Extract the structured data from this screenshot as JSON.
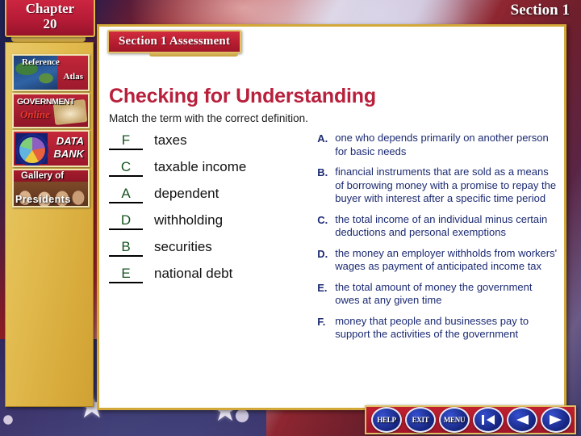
{
  "header": {
    "chapter_line1": "Chapter",
    "chapter_line2": "20",
    "section_label": "Section 1"
  },
  "sidebar": {
    "buttons": [
      {
        "name": "reference-atlas",
        "line1": "Reference",
        "line2": "Atlas"
      },
      {
        "name": "government-online",
        "line1": "GOVERNMENT",
        "line2": "Online"
      },
      {
        "name": "data-bank",
        "line1": "DATA",
        "line2": "BANK"
      },
      {
        "name": "gallery-of-presidents",
        "line1": "Gallery of",
        "line2": "Presidents"
      }
    ]
  },
  "main": {
    "assessment_banner": "Section 1 Assessment",
    "title": "Checking for Understanding",
    "instruction": "Match the term with the correct definition.",
    "terms": [
      {
        "answer": "F",
        "term": "taxes"
      },
      {
        "answer": "C",
        "term": "taxable income"
      },
      {
        "answer": "A",
        "term": "dependent"
      },
      {
        "answer": "D",
        "term": "withholding"
      },
      {
        "answer": "B",
        "term": "securities"
      },
      {
        "answer": "E",
        "term": "national debt"
      }
    ],
    "definitions": [
      {
        "letter": "A.",
        "text": "one who depends primarily on another person for basic needs"
      },
      {
        "letter": "B.",
        "text": "financial instruments that are sold as a means of borrowing money with a promise to repay the buyer with interest after a specific time period"
      },
      {
        "letter": "C.",
        "text": "the total income of an individual minus certain deductions and personal exemptions"
      },
      {
        "letter": "D.",
        "text": "the money an employer withholds from workers' wages as payment of anticipated income tax"
      },
      {
        "letter": "E.",
        "text": "the total amount of money the government owes at any given time"
      },
      {
        "letter": "F.",
        "text": "money that people and businesses pay to support the activities of the government"
      }
    ]
  },
  "nav": {
    "help": "HELP",
    "exit": "EXIT",
    "menu": "MENU"
  },
  "colors": {
    "banner_red": "#b81d31",
    "title_crimson": "#b8203c",
    "answer_green": "#14531f",
    "definition_navy": "#1b2a72",
    "gold_border": "#d2a838",
    "sidebar_gold": "#e3bd52",
    "nav_blue": "#16247e"
  }
}
